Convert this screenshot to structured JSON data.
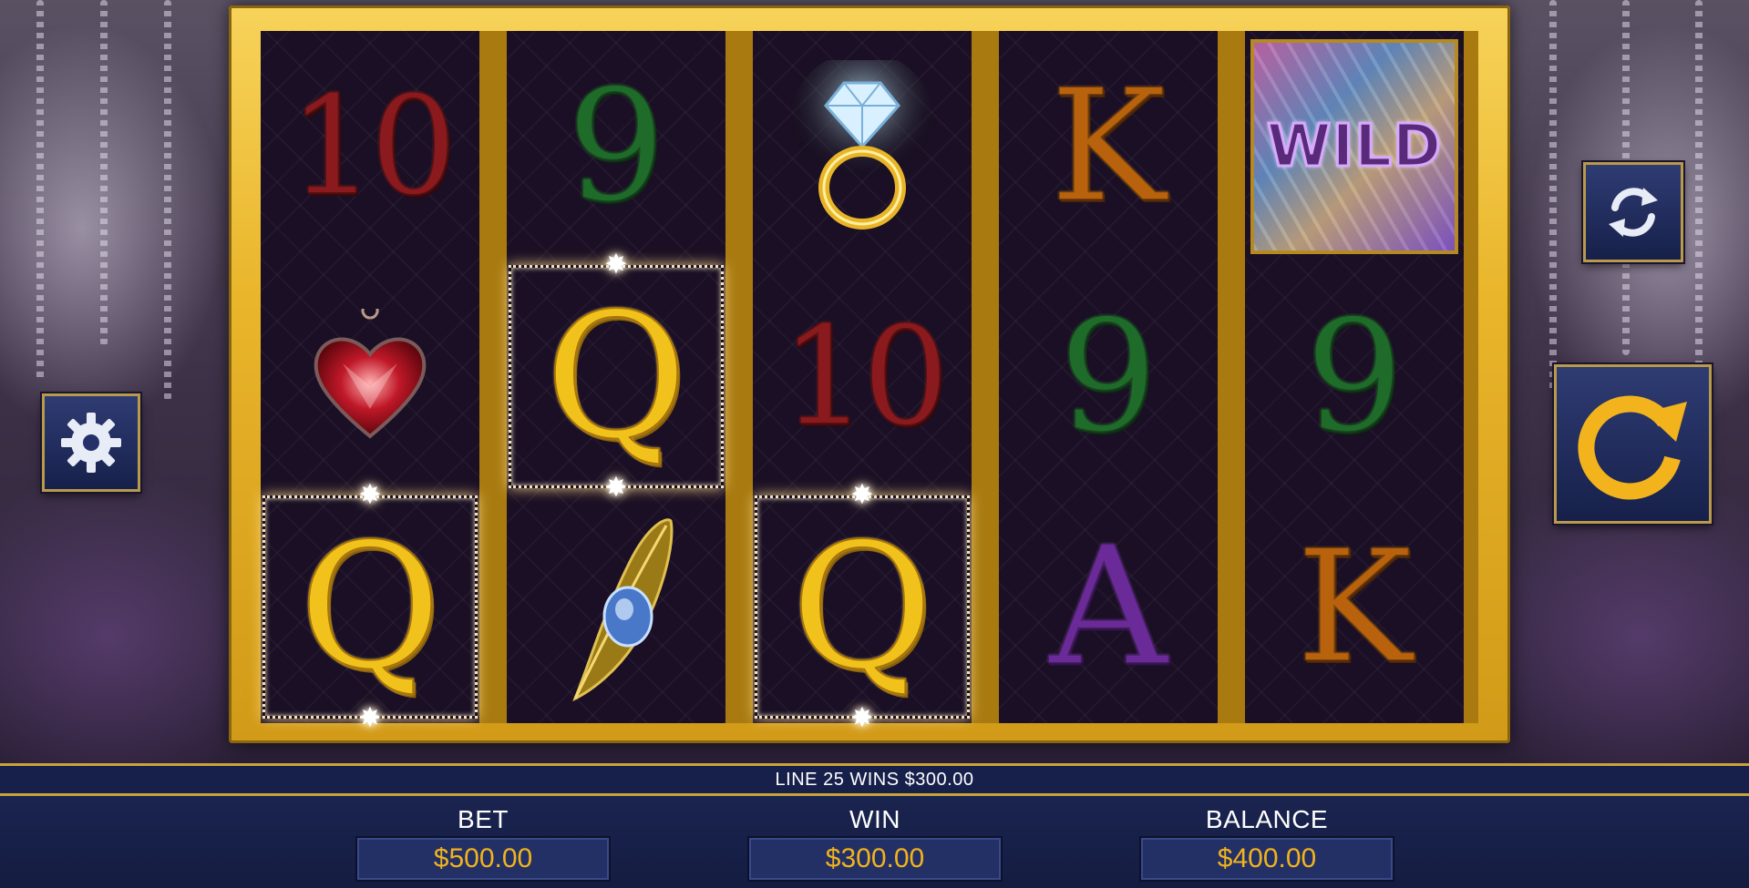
{
  "game": {
    "message": "LINE 25 WINS $300.00"
  },
  "reels": [
    {
      "symbols": [
        {
          "name": "10",
          "type": "text",
          "win": false
        },
        {
          "name": "heart-pendant",
          "type": "icon",
          "win": false
        },
        {
          "name": "Q",
          "type": "text",
          "win": true
        }
      ]
    },
    {
      "symbols": [
        {
          "name": "9",
          "type": "text",
          "win": false
        },
        {
          "name": "Q",
          "type": "text",
          "win": true
        },
        {
          "name": "feather-brooch",
          "type": "icon",
          "win": false
        }
      ]
    },
    {
      "symbols": [
        {
          "name": "diamond-ring",
          "type": "icon",
          "win": false
        },
        {
          "name": "10",
          "type": "text",
          "win": false
        },
        {
          "name": "Q",
          "type": "text",
          "win": true
        }
      ]
    },
    {
      "symbols": [
        {
          "name": "K",
          "type": "text",
          "win": false
        },
        {
          "name": "9",
          "type": "text",
          "win": false
        },
        {
          "name": "A",
          "type": "text",
          "win": false
        }
      ]
    },
    {
      "symbols": [
        {
          "name": "WILD",
          "type": "wild",
          "win": false
        },
        {
          "name": "9",
          "type": "text",
          "win": false
        },
        {
          "name": "K",
          "type": "text",
          "win": false
        }
      ]
    }
  ],
  "controls": {
    "settings_icon": "gear-icon",
    "autoplay_icon": "refresh-arrows-icon",
    "spin_icon": "spin-arrow-icon"
  },
  "meters": {
    "bet_label": "BET",
    "bet_value": "$500.00",
    "win_label": "WIN",
    "win_value": "$300.00",
    "balance_label": "BALANCE",
    "balance_value": "$400.00"
  },
  "colors": {
    "frame_gold": "#e9b52a",
    "panel_navy": "#17204a",
    "value_gold": "#f2b31c"
  }
}
